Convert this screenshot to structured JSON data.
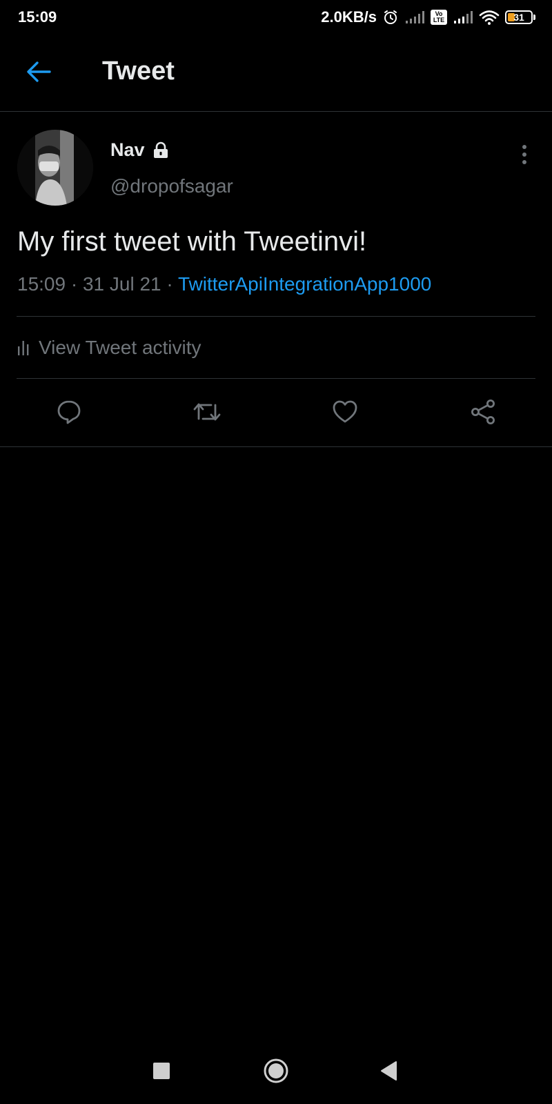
{
  "status_bar": {
    "time": "15:09",
    "net_speed": "2.0KB/s",
    "volte_label": "Vo LTE",
    "battery_level": "31",
    "battery_fraction": 0.31,
    "icons": [
      "alarm-icon",
      "signal-icon",
      "volte-icon",
      "signal-icon",
      "wifi-icon",
      "battery-icon"
    ]
  },
  "header": {
    "title": "Tweet",
    "back_icon": "arrow-left-icon"
  },
  "tweet": {
    "display_name": "Nav",
    "protected_icon": "lock-icon",
    "username": "@dropofsagar",
    "text": "My first tweet with Tweetinvi!",
    "time": "15:09",
    "separator": "·",
    "date": "31 Jul 21",
    "source": "TwitterApiIntegrationApp1000",
    "activity_label": "View Tweet activity",
    "activity_icon": "bar-chart-icon",
    "more_icon": "more-vertical-icon"
  },
  "actions": {
    "icons": [
      "reply-icon",
      "retweet-icon",
      "like-icon",
      "share-icon"
    ]
  },
  "nav_bar": {
    "icons": [
      "recent-apps-icon",
      "home-icon",
      "back-icon"
    ]
  },
  "colors": {
    "background": "#000000",
    "text_primary": "#e7e9ea",
    "text_secondary": "#71767b",
    "accent": "#1d9bf0",
    "divider": "#2f3336",
    "battery_fill": "#f0a020"
  }
}
